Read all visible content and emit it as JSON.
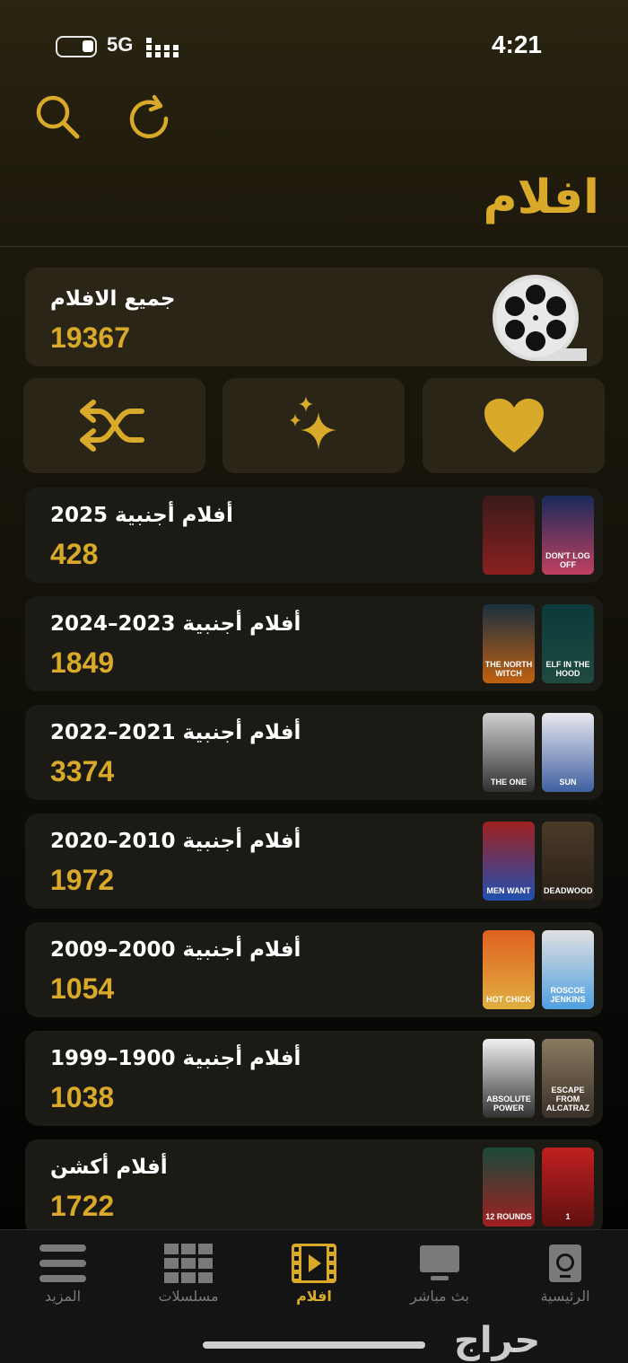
{
  "status": {
    "network": "5G",
    "time": "4:21"
  },
  "header": {
    "title": "افلام"
  },
  "all_movies": {
    "name": "جميع الافلام",
    "count": "19367"
  },
  "quick_actions": [
    "shuffle-icon",
    "sparkles-icon",
    "heart-icon"
  ],
  "categories": [
    {
      "name": "أفلام أجنبية 2025",
      "count": "428",
      "thumbs": [
        {
          "text": "",
          "colors": [
            "#3a1a1a",
            "#8a2020"
          ]
        },
        {
          "text": "DON'T LOG OFF",
          "colors": [
            "#1a2a5a",
            "#c04060"
          ]
        }
      ]
    },
    {
      "name": "أفلام أجنبية 2023–2024",
      "count": "1849",
      "thumbs": [
        {
          "text": "THE NORTH WITCH",
          "colors": [
            "#1a3040",
            "#c06010"
          ]
        },
        {
          "text": "ELF IN THE HOOD",
          "colors": [
            "#0a3a3a",
            "#204a40"
          ]
        }
      ]
    },
    {
      "name": "أفلام أجنبية 2021–2022",
      "count": "3374",
      "thumbs": [
        {
          "text": "THE ONE",
          "colors": [
            "#d0d0d0",
            "#303030"
          ]
        },
        {
          "text": "SUN",
          "colors": [
            "#e8e8f0",
            "#4060a0"
          ]
        }
      ]
    },
    {
      "name": "أفلام أجنبية 2010–2020",
      "count": "1972",
      "thumbs": [
        {
          "text": "MEN WANT",
          "colors": [
            "#a02020",
            "#2050b0"
          ]
        },
        {
          "text": "DEADWOOD",
          "colors": [
            "#4a3a28",
            "#2a2018"
          ]
        }
      ]
    },
    {
      "name": "أفلام أجنبية 2000–2009",
      "count": "1054",
      "thumbs": [
        {
          "text": "HOT CHICK",
          "colors": [
            "#e06020",
            "#e0b040"
          ]
        },
        {
          "text": "ROSCOE JENKINS",
          "colors": [
            "#e0e0e0",
            "#50a0e0"
          ]
        }
      ]
    },
    {
      "name": "أفلام أجنبية 1900–1999",
      "count": "1038",
      "thumbs": [
        {
          "text": "ABSOLUTE POWER",
          "colors": [
            "#f0f0f0",
            "#303030"
          ]
        },
        {
          "text": "ESCAPE FROM ALCATRAZ",
          "colors": [
            "#8a7a60",
            "#3a3028"
          ]
        }
      ]
    },
    {
      "name": "أفلام أكشن",
      "count": "1722",
      "thumbs": [
        {
          "text": "12 ROUNDS",
          "colors": [
            "#1a4a3a",
            "#a02020"
          ]
        },
        {
          "text": "1",
          "colors": [
            "#c02020",
            "#601010"
          ]
        }
      ]
    }
  ],
  "tabs": [
    {
      "label": "المزيد",
      "icon": "menu-icon"
    },
    {
      "label": "مسلسلات",
      "icon": "grid-icon"
    },
    {
      "label": "افلام",
      "icon": "film-icon",
      "active": true
    },
    {
      "label": "بث مباشر",
      "icon": "tv-icon"
    },
    {
      "label": "الرئيسية",
      "icon": "home-icon"
    }
  ],
  "watermark": "حراج"
}
